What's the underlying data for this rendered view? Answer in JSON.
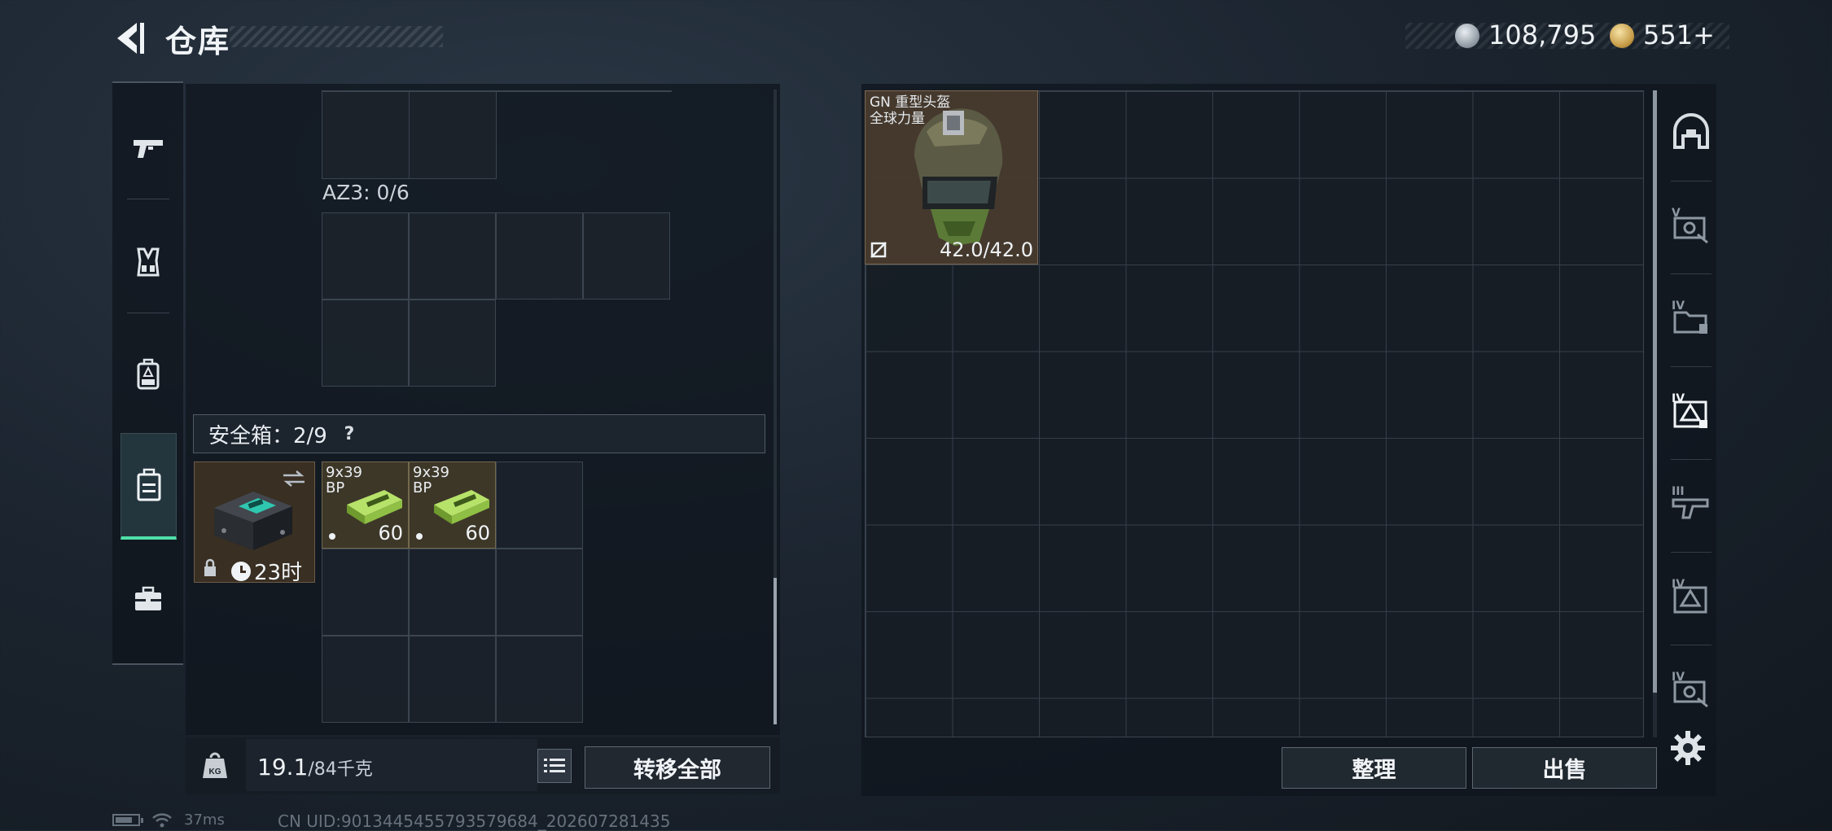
{
  "header": {
    "title": "仓库"
  },
  "currency": {
    "silver": "108,795",
    "gold": "551",
    "gold_plus": "+"
  },
  "left_nav": [
    "pistol-icon",
    "vest-icon",
    "backpack-icon",
    "safe-box-icon",
    "toolbox-icon"
  ],
  "left_nav_active": "safe-box-icon",
  "container": {
    "az3_label": "AZ3: 0/6"
  },
  "safe_box": {
    "title": "安全箱：2/9",
    "help": "?",
    "timer": "23时",
    "ammo": [
      {
        "caliber_line1": "9x39",
        "caliber_line2": "BP",
        "count": "60"
      },
      {
        "caliber_line1": "9x39",
        "caliber_line2": "BP",
        "count": "60"
      }
    ]
  },
  "footer_left": {
    "weight_current": "19.1",
    "weight_max": "/84千克",
    "transfer_all": "转移全部"
  },
  "stash": {
    "helmet": {
      "name_line1": "GN 重型头盔",
      "name_line2": "全球力量",
      "durability": "42.0/42.0"
    },
    "sort_button": "整理",
    "sell_button": "出售"
  },
  "right_nav": [
    "helmet-slot-icon",
    "stash-v-icon",
    "stash-iv-icon",
    "stash-iv-active-icon",
    "stash-iii-icon",
    "stash-iv-2-icon",
    "stash-iv-3-icon"
  ],
  "status_bar": {
    "ping": "37ms",
    "uid": "CN UID:9013445455793579684_202607281435"
  },
  "colors": {
    "accent_green": "#50e0a9",
    "item_brown": "#483a2e",
    "ammo_green": "#9ccf53"
  }
}
